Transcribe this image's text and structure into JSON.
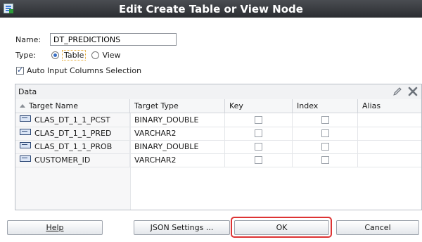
{
  "window": {
    "title": "Edit Create Table or View Node"
  },
  "form": {
    "name_label": "Name:",
    "name_value": "DT_PREDICTIONS",
    "type_label": "Type:",
    "type_table": "Table",
    "type_view": "View",
    "auto_input_label": "Auto Input Columns Selection"
  },
  "data_panel": {
    "title": "Data",
    "columns": [
      "Target Name",
      "Target Type",
      "Key",
      "Index",
      "Alias"
    ],
    "rows": [
      {
        "name": "CLAS_DT_1_1_PCST",
        "type": "BINARY_DOUBLE",
        "key": false,
        "index": false,
        "alias": ""
      },
      {
        "name": "CLAS_DT_1_1_PRED",
        "type": "VARCHAR2",
        "key": false,
        "index": false,
        "alias": ""
      },
      {
        "name": "CLAS_DT_1_1_PROB",
        "type": "BINARY_DOUBLE",
        "key": false,
        "index": false,
        "alias": ""
      },
      {
        "name": "CUSTOMER_ID",
        "type": "VARCHAR2",
        "key": false,
        "index": false,
        "alias": ""
      }
    ]
  },
  "buttons": {
    "help": "Help",
    "json_settings": "JSON Settings ...",
    "ok": "OK",
    "cancel": "Cancel"
  }
}
